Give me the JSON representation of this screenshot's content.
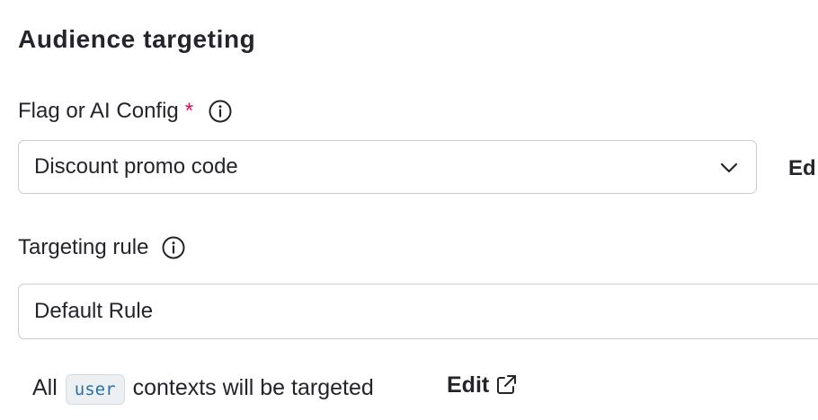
{
  "section": {
    "title": "Audience targeting"
  },
  "flag_field": {
    "label": "Flag or AI Config",
    "required_marker": "*",
    "info_icon": "info-circle-icon",
    "selected_value": "Discount promo code",
    "dropdown_icon": "chevron-down-icon",
    "edit_label_cutoff": "Ed"
  },
  "rule_field": {
    "label": "Targeting rule",
    "info_icon": "info-circle-icon",
    "selected_value": "Default Rule"
  },
  "summary": {
    "prefix": "All",
    "context_kind": "user",
    "suffix": "contexts will be targeted",
    "edit_label": "Edit",
    "edit_icon": "external-link-icon"
  },
  "colors": {
    "text": "#23252b",
    "required": "#d8134f",
    "border": "#c9cbd1",
    "code_text": "#2a6fa5",
    "code_bg": "#edf0f3"
  }
}
